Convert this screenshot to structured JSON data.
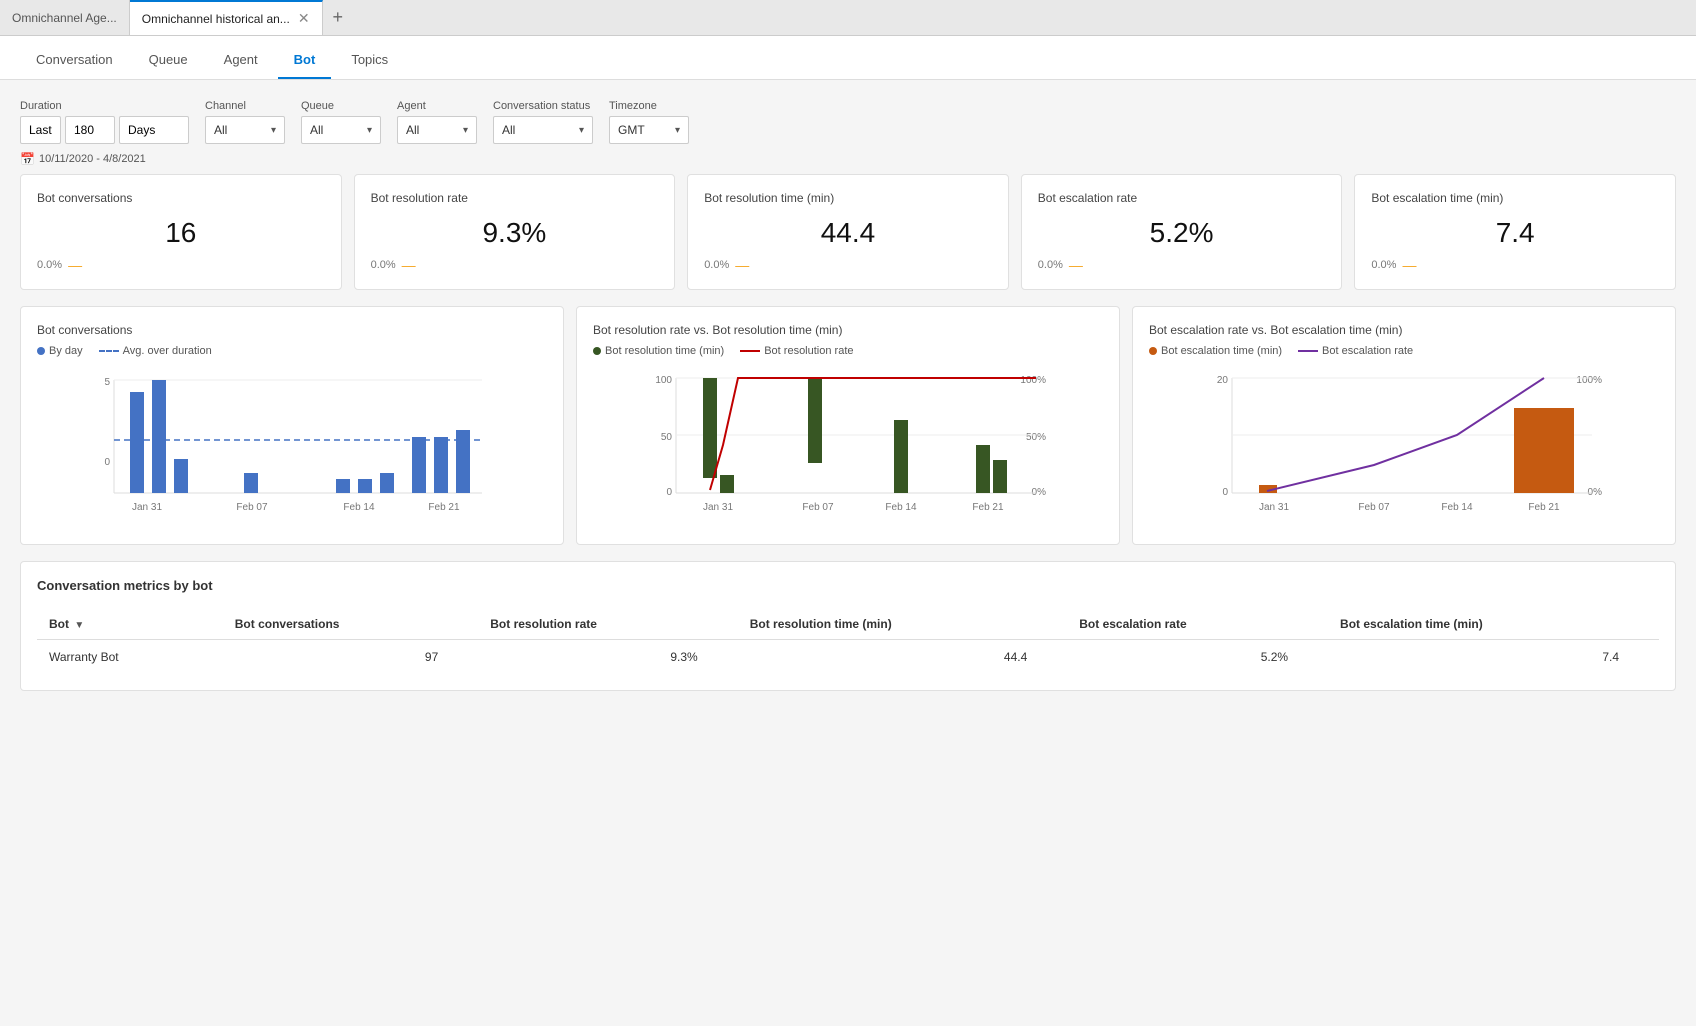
{
  "browser": {
    "tabs": [
      {
        "label": "Omnichannel Age...",
        "active": false
      },
      {
        "label": "Omnichannel historical an...",
        "active": true
      }
    ],
    "add_tab_label": "+"
  },
  "nav": {
    "tabs": [
      {
        "label": "Conversation",
        "active": false
      },
      {
        "label": "Queue",
        "active": false
      },
      {
        "label": "Agent",
        "active": false
      },
      {
        "label": "Bot",
        "active": true
      },
      {
        "label": "Topics",
        "active": false
      }
    ]
  },
  "filters": {
    "duration_label": "Duration",
    "duration_preset": "Last",
    "duration_value": "180",
    "duration_unit": "Days",
    "channel_label": "Channel",
    "channel_value": "All",
    "queue_label": "Queue",
    "queue_value": "All",
    "agent_label": "Agent",
    "agent_value": "All",
    "conv_status_label": "Conversation status",
    "conv_status_value": "All",
    "timezone_label": "Timezone",
    "timezone_value": "GMT",
    "date_range": "10/11/2020 - 4/8/2021"
  },
  "kpis": [
    {
      "title": "Bot conversations",
      "value": "16",
      "change": "0.0%",
      "indicator": "—"
    },
    {
      "title": "Bot resolution rate",
      "value": "9.3%",
      "change": "0.0%",
      "indicator": "—"
    },
    {
      "title": "Bot resolution time (min)",
      "value": "44.4",
      "change": "0.0%",
      "indicator": "—"
    },
    {
      "title": "Bot escalation rate",
      "value": "5.2%",
      "change": "0.0%",
      "indicator": "—"
    },
    {
      "title": "Bot escalation time (min)",
      "value": "7.4",
      "change": "0.0%",
      "indicator": "—"
    }
  ],
  "charts": {
    "chart1": {
      "title": "Bot conversations",
      "legend": [
        {
          "type": "dot",
          "color": "#4472C4",
          "label": "By day"
        },
        {
          "type": "dash",
          "color": "#4472C4",
          "label": "Avg. over duration"
        }
      ],
      "x_labels": [
        "Jan 31",
        "Feb 07",
        "Feb 14",
        "Feb 21"
      ],
      "y_max": 5,
      "bars": [
        {
          "x": 0.08,
          "height": 0.9,
          "value": 4.5
        },
        {
          "x": 0.14,
          "height": 1.0,
          "value": 5
        },
        {
          "x": 0.2,
          "height": 0.3,
          "value": 1.5
        },
        {
          "x": 0.38,
          "height": 0.18,
          "value": 0.9
        },
        {
          "x": 0.62,
          "height": 0.12,
          "value": 0.6
        },
        {
          "x": 0.68,
          "height": 0.12,
          "value": 0.6
        },
        {
          "x": 0.74,
          "height": 0.18,
          "value": 0.9
        },
        {
          "x": 0.8,
          "height": 0.5,
          "value": 2.5
        },
        {
          "x": 0.86,
          "height": 0.5,
          "value": 2.5
        },
        {
          "x": 0.92,
          "height": 0.55,
          "value": 2.8
        }
      ],
      "avg_y": 0.6
    },
    "chart2": {
      "title": "Bot resolution rate vs. Bot resolution time (min)",
      "legend": [
        {
          "type": "dot",
          "color": "#375623",
          "label": "Bot resolution time (min)"
        },
        {
          "type": "line",
          "color": "#C00000",
          "label": "Bot resolution rate"
        }
      ],
      "x_labels": [
        "Jan 31",
        "Feb 07",
        "Feb 14",
        "Feb 21"
      ],
      "y_left_max": 100,
      "y_right_max": "100%"
    },
    "chart3": {
      "title": "Bot escalation rate vs. Bot escalation time (min)",
      "legend": [
        {
          "type": "dot",
          "color": "#C55A11",
          "label": "Bot escalation time (min)"
        },
        {
          "type": "line",
          "color": "#7030A0",
          "label": "Bot escalation rate"
        }
      ],
      "x_labels": [
        "Jan 31",
        "Feb 07",
        "Feb 14",
        "Feb 21"
      ],
      "y_left_max": 20,
      "y_right_max": "100%"
    }
  },
  "table": {
    "section_title": "Conversation metrics by bot",
    "columns": [
      {
        "label": "Bot",
        "sortable": true
      },
      {
        "label": "Bot conversations",
        "sortable": true,
        "sort_dir": "desc"
      },
      {
        "label": "Bot resolution rate",
        "sortable": false
      },
      {
        "label": "Bot resolution time (min)",
        "sortable": false
      },
      {
        "label": "Bot escalation rate",
        "sortable": false
      },
      {
        "label": "Bot escalation time (min)",
        "sortable": false
      }
    ],
    "rows": [
      {
        "bot": "Warranty Bot",
        "conversations": "97",
        "resolution_rate": "9.3%",
        "resolution_time": "44.4",
        "escalation_rate": "5.2%",
        "escalation_time": "7.4"
      }
    ]
  }
}
